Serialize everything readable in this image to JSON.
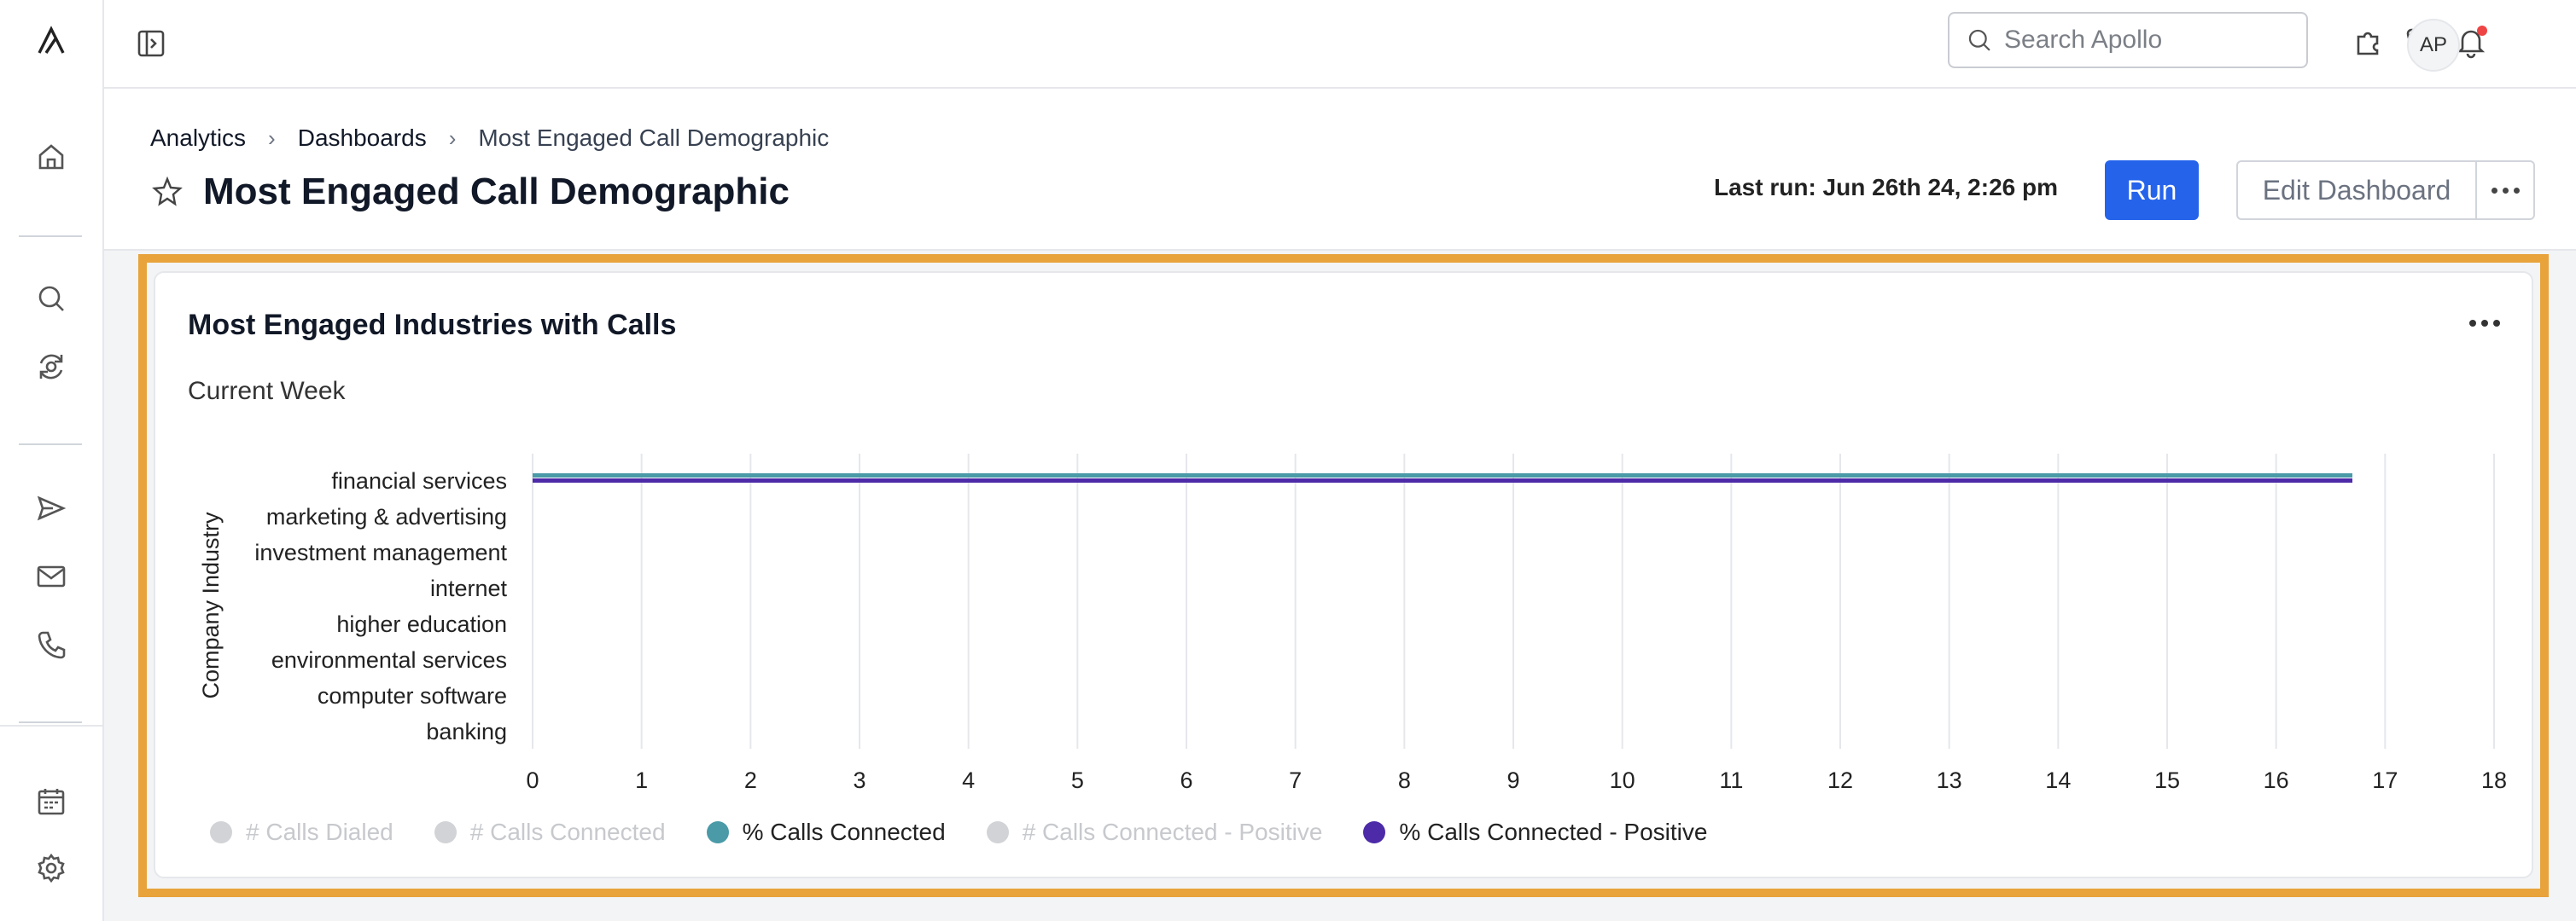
{
  "topbar": {
    "search_placeholder": "Search Apollo",
    "avatar_initials": "AP"
  },
  "breadcrumb": [
    "Analytics",
    "Dashboards",
    "Most Engaged Call Demographic"
  ],
  "page": {
    "title": "Most Engaged Call Demographic",
    "last_run": "Last run: Jun 26th 24, 2:26 pm",
    "run_label": "Run",
    "edit_label": "Edit Dashboard"
  },
  "card": {
    "title": "Most Engaged Industries with Calls",
    "subtitle": "Current Week"
  },
  "colors": {
    "accent": "#2563eb",
    "highlight": "#e8a33b",
    "series_teal": "#4a9aa8",
    "series_purple": "#4c2aa8",
    "disabled": "#d1d3d6"
  },
  "chart_data": {
    "type": "bar",
    "orientation": "horizontal",
    "ylabel": "Company Industry",
    "categories": [
      "financial services",
      "marketing & advertising",
      "investment management",
      "internet",
      "higher education",
      "environmental services",
      "computer software",
      "banking"
    ],
    "x_ticks": [
      "0",
      "1",
      "2",
      "3",
      "4",
      "5",
      "6",
      "7",
      "8",
      "9",
      "10",
      "11",
      "12",
      "13",
      "14",
      "15",
      "16",
      "17",
      "18"
    ],
    "xlim": [
      0,
      18
    ],
    "grid": true,
    "legend_position": "bottom",
    "series": [
      {
        "name": "# Calls Dialed",
        "visible": false,
        "color": "#d1d3d6",
        "values": []
      },
      {
        "name": "# Calls Connected",
        "visible": false,
        "color": "#d1d3d6",
        "values": []
      },
      {
        "name": "% Calls Connected",
        "visible": true,
        "color": "#4a9aa8",
        "values": [
          16.7,
          0,
          0,
          0,
          0,
          0,
          0,
          0
        ]
      },
      {
        "name": "# Calls Connected - Positive",
        "visible": false,
        "color": "#d1d3d6",
        "values": []
      },
      {
        "name": "% Calls Connected - Positive",
        "visible": true,
        "color": "#4c2aa8",
        "values": [
          16.7,
          0,
          0,
          0,
          0,
          0,
          0,
          0
        ]
      }
    ]
  }
}
